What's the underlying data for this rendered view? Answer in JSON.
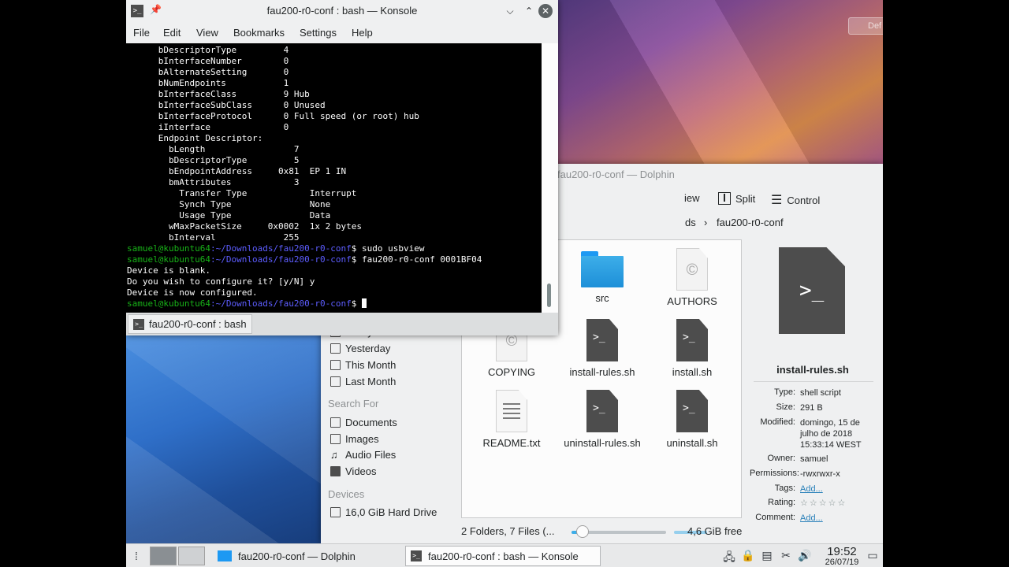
{
  "konsole": {
    "title": "fau200-r0-conf : bash — Konsole",
    "menu": [
      "File",
      "Edit",
      "View",
      "Bookmarks",
      "Settings",
      "Help"
    ],
    "lines": [
      {
        "t": "      bDescriptorType         4"
      },
      {
        "t": "      bInterfaceNumber        0"
      },
      {
        "t": "      bAlternateSetting       0"
      },
      {
        "t": "      bNumEndpoints           1"
      },
      {
        "t": "      bInterfaceClass         9 Hub"
      },
      {
        "t": "      bInterfaceSubClass      0 Unused"
      },
      {
        "t": "      bInterfaceProtocol      0 Full speed (or root) hub"
      },
      {
        "t": "      iInterface              0"
      },
      {
        "t": "      Endpoint Descriptor:"
      },
      {
        "t": "        bLength                 7"
      },
      {
        "t": "        bDescriptorType         5"
      },
      {
        "t": "        bEndpointAddress     0x81  EP 1 IN"
      },
      {
        "t": "        bmAttributes            3"
      },
      {
        "t": "          Transfer Type            Interrupt"
      },
      {
        "t": "          Synch Type               None"
      },
      {
        "t": "          Usage Type               Data"
      },
      {
        "t": "        wMaxPacketSize     0x0002  1x 2 bytes"
      },
      {
        "t": "        bInterval             255"
      },
      {
        "user": "samuel@kubuntu64",
        "path": ":~/Downloads/fau200-r0-conf",
        "cmd": "$ sudo usbview"
      },
      {
        "user": "samuel@kubuntu64",
        "path": ":~/Downloads/fau200-r0-conf",
        "cmd": "$ fau200-r0-conf 0001BF04"
      },
      {
        "t": "Device is blank."
      },
      {
        "t": "Do you wish to configure it? [y/N] y"
      },
      {
        "t": "Device is now configured."
      },
      {
        "user": "samuel@kubuntu64",
        "path": ":~/Downloads/fau200-r0-conf",
        "cmd": "$ "
      }
    ],
    "tab_label": "fau200-r0-conf : bash"
  },
  "dolphin": {
    "title": "fau200-r0-conf — Dolphin",
    "toolbar": {
      "view_partial": "iew",
      "split": "Split",
      "control": "Control"
    },
    "crumbs": {
      "prev_partial": "ds",
      "current": "fau200-r0-conf"
    },
    "places": {
      "recent": [
        {
          "label": "Today",
          "icon": "calendar-icon"
        },
        {
          "label": "Yesterday",
          "icon": "calendar-icon"
        },
        {
          "label": "This Month",
          "icon": "calendar-icon"
        },
        {
          "label": "Last Month",
          "icon": "calendar-icon"
        }
      ],
      "search_for": "Search For",
      "search": [
        {
          "label": "Documents",
          "icon": "document-icon"
        },
        {
          "label": "Images",
          "icon": "image-icon"
        },
        {
          "label": "Audio Files",
          "icon": "music-icon"
        },
        {
          "label": "Videos",
          "icon": "video-icon"
        }
      ],
      "devices_label": "Devices",
      "devices": [
        {
          "label": "16,0 GiB Hard Drive",
          "icon": "hard-drive-icon"
        }
      ]
    },
    "files": [
      {
        "name": "src",
        "kind": "folder"
      },
      {
        "name": "AUTHORS",
        "kind": "doc"
      },
      {
        "name": "COPYING",
        "kind": "doc"
      },
      {
        "name": "install-rules.sh",
        "kind": "sh"
      },
      {
        "name": "install.sh",
        "kind": "sh"
      },
      {
        "name": "README.txt",
        "kind": "txt"
      },
      {
        "name": "uninstall-rules.sh",
        "kind": "sh"
      },
      {
        "name": "uninstall.sh",
        "kind": "sh"
      }
    ],
    "info": {
      "name": "install-rules.sh",
      "rows": [
        {
          "k": "Type:",
          "v": "shell script"
        },
        {
          "k": "Size:",
          "v": "291 B"
        },
        {
          "k": "Modified:",
          "v": "domingo, 15 de julho de 2018 15:33:14 WEST"
        },
        {
          "k": "Owner:",
          "v": "samuel"
        },
        {
          "k": "Permissions:",
          "v": "-rwxrwxr-x"
        },
        {
          "k": "Tags:",
          "v": "Add..."
        },
        {
          "k": "Rating:",
          "v": "☆☆☆☆☆"
        },
        {
          "k": "Comment:",
          "v": "Add..."
        }
      ]
    },
    "status": {
      "summary": "2 Folders, 7 Files (...",
      "free": "4,6 GiB free",
      "zoom_fraction": 0.08
    }
  },
  "taskbar": {
    "tasks": [
      {
        "label": "fau200-r0-conf — Dolphin",
        "active": false
      },
      {
        "label": "fau200-r0-conf : bash — Konsole",
        "active": true
      }
    ],
    "clock": {
      "time": "19:52",
      "date": "26/07/19"
    }
  },
  "desktop": {
    "widget_partial": "Def"
  }
}
